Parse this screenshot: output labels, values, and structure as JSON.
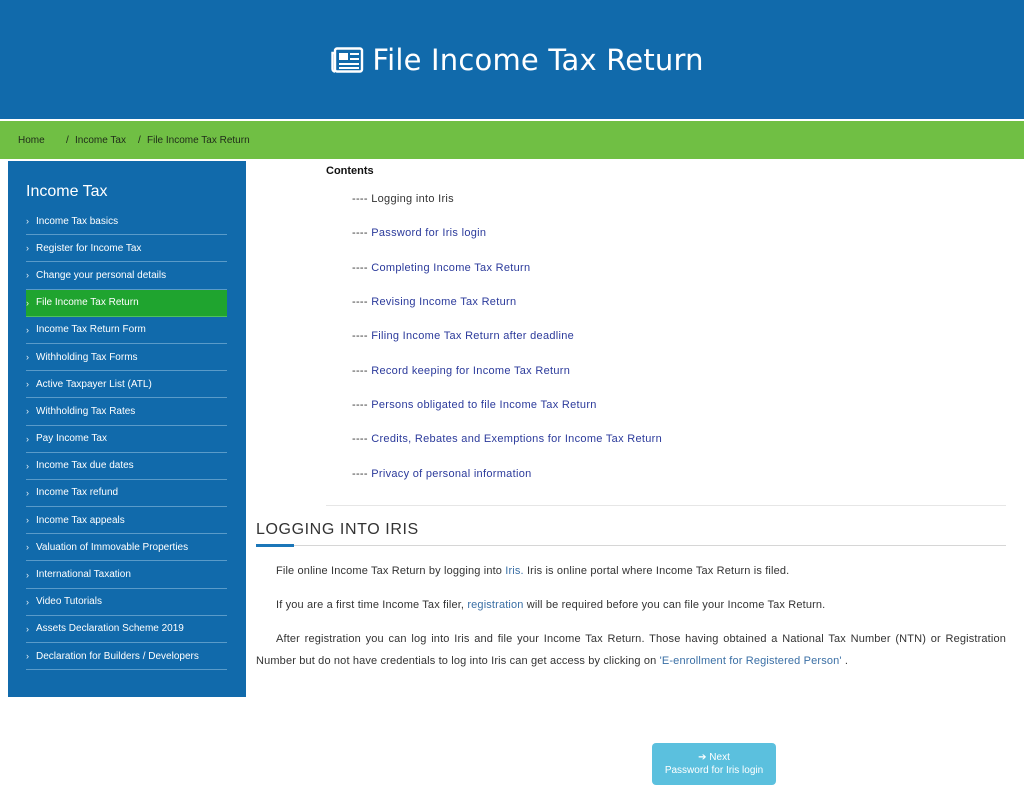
{
  "header": {
    "title": "File Income Tax Return",
    "icon": "newspaper-icon"
  },
  "breadcrumb": {
    "home": "Home",
    "separator": "/",
    "income_tax": "Income Tax",
    "current": "File Income Tax Return"
  },
  "sidebar": {
    "title": "Income Tax",
    "items": [
      {
        "label": "Income Tax basics"
      },
      {
        "label": "Register for Income Tax"
      },
      {
        "label": "Change your personal details"
      },
      {
        "label": "File Income Tax Return"
      },
      {
        "label": "Income Tax Return Form"
      },
      {
        "label": "Withholding Tax Forms"
      },
      {
        "label": "Active Taxpayer List (ATL)"
      },
      {
        "label": "Withholding Tax Rates"
      },
      {
        "label": "Pay Income Tax"
      },
      {
        "label": "Income Tax due dates"
      },
      {
        "label": "Income Tax refund"
      },
      {
        "label": "Income Tax appeals"
      },
      {
        "label": "Valuation of Immovable Properties"
      },
      {
        "label": "International Taxation"
      },
      {
        "label": "Video Tutorials"
      },
      {
        "label": "Assets Declaration Scheme 2019"
      },
      {
        "label": "Declaration for Builders / Developers"
      }
    ]
  },
  "contents": {
    "heading": "Contents",
    "dash": "----",
    "items": [
      {
        "label": "Logging into Iris"
      },
      {
        "label": "Password for Iris login"
      },
      {
        "label": "Completing Income Tax Return"
      },
      {
        "label": "Revising Income Tax Return"
      },
      {
        "label": "Filing Income Tax Return after deadline"
      },
      {
        "label": "Record keeping for Income Tax Return"
      },
      {
        "label": "Persons obligated to file Income Tax Return"
      },
      {
        "label": "Credits, Rebates and Exemptions for Income Tax Return"
      },
      {
        "label": "Privacy of personal information"
      }
    ]
  },
  "section": {
    "title": "LOGGING INTO IRIS",
    "p1_before": "File online Income Tax Return by logging into ",
    "p1_link": "Iris.",
    "p1_after": " Iris is online portal where Income Tax Return is filed.",
    "p2_before": "If you are a first time Income Tax filer, ",
    "p2_link": "registration",
    "p2_after": " will be required before you can file your Income Tax Return.",
    "p3_before": "After registration you can log into Iris and file your Income Tax Return. Those having obtained a National Tax Number (NTN) or Registration Number but do not have credentials to log into Iris can get access by clicking on ",
    "p3_link": "'E-enrollment for Registered Person'",
    "p3_after": " ."
  },
  "next_button": {
    "label": "Next",
    "sublabel": "Password for Iris login"
  }
}
